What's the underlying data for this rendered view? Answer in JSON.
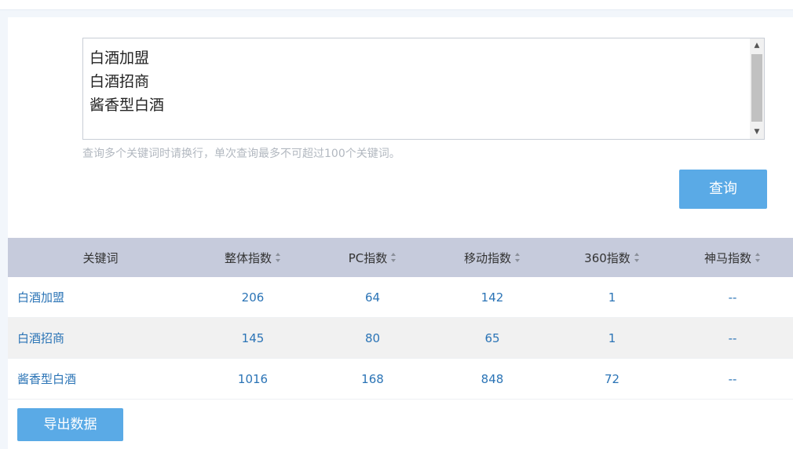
{
  "keywords_input": {
    "lines": [
      "白酒加盟",
      "白酒招商",
      "酱香型白酒"
    ]
  },
  "hint_text": "查询多个关键词时请换行，单次查询最多不可超过100个关键词。",
  "query_button": "查询",
  "table": {
    "headers": [
      "关键词",
      "整体指数",
      "PC指数",
      "移动指数",
      "360指数",
      "神马指数"
    ],
    "rows": [
      [
        "白酒加盟",
        "206",
        "64",
        "142",
        "1",
        "--"
      ],
      [
        "白酒招商",
        "145",
        "80",
        "65",
        "1",
        "--"
      ],
      [
        "酱香型白酒",
        "1016",
        "168",
        "848",
        "72",
        "--"
      ]
    ]
  },
  "export_button": "导出数据",
  "colors": {
    "accent": "#5aaae6",
    "header_bg": "#c6cbdc",
    "link": "#2b74b6",
    "alt_row": "#f1f1f1"
  }
}
